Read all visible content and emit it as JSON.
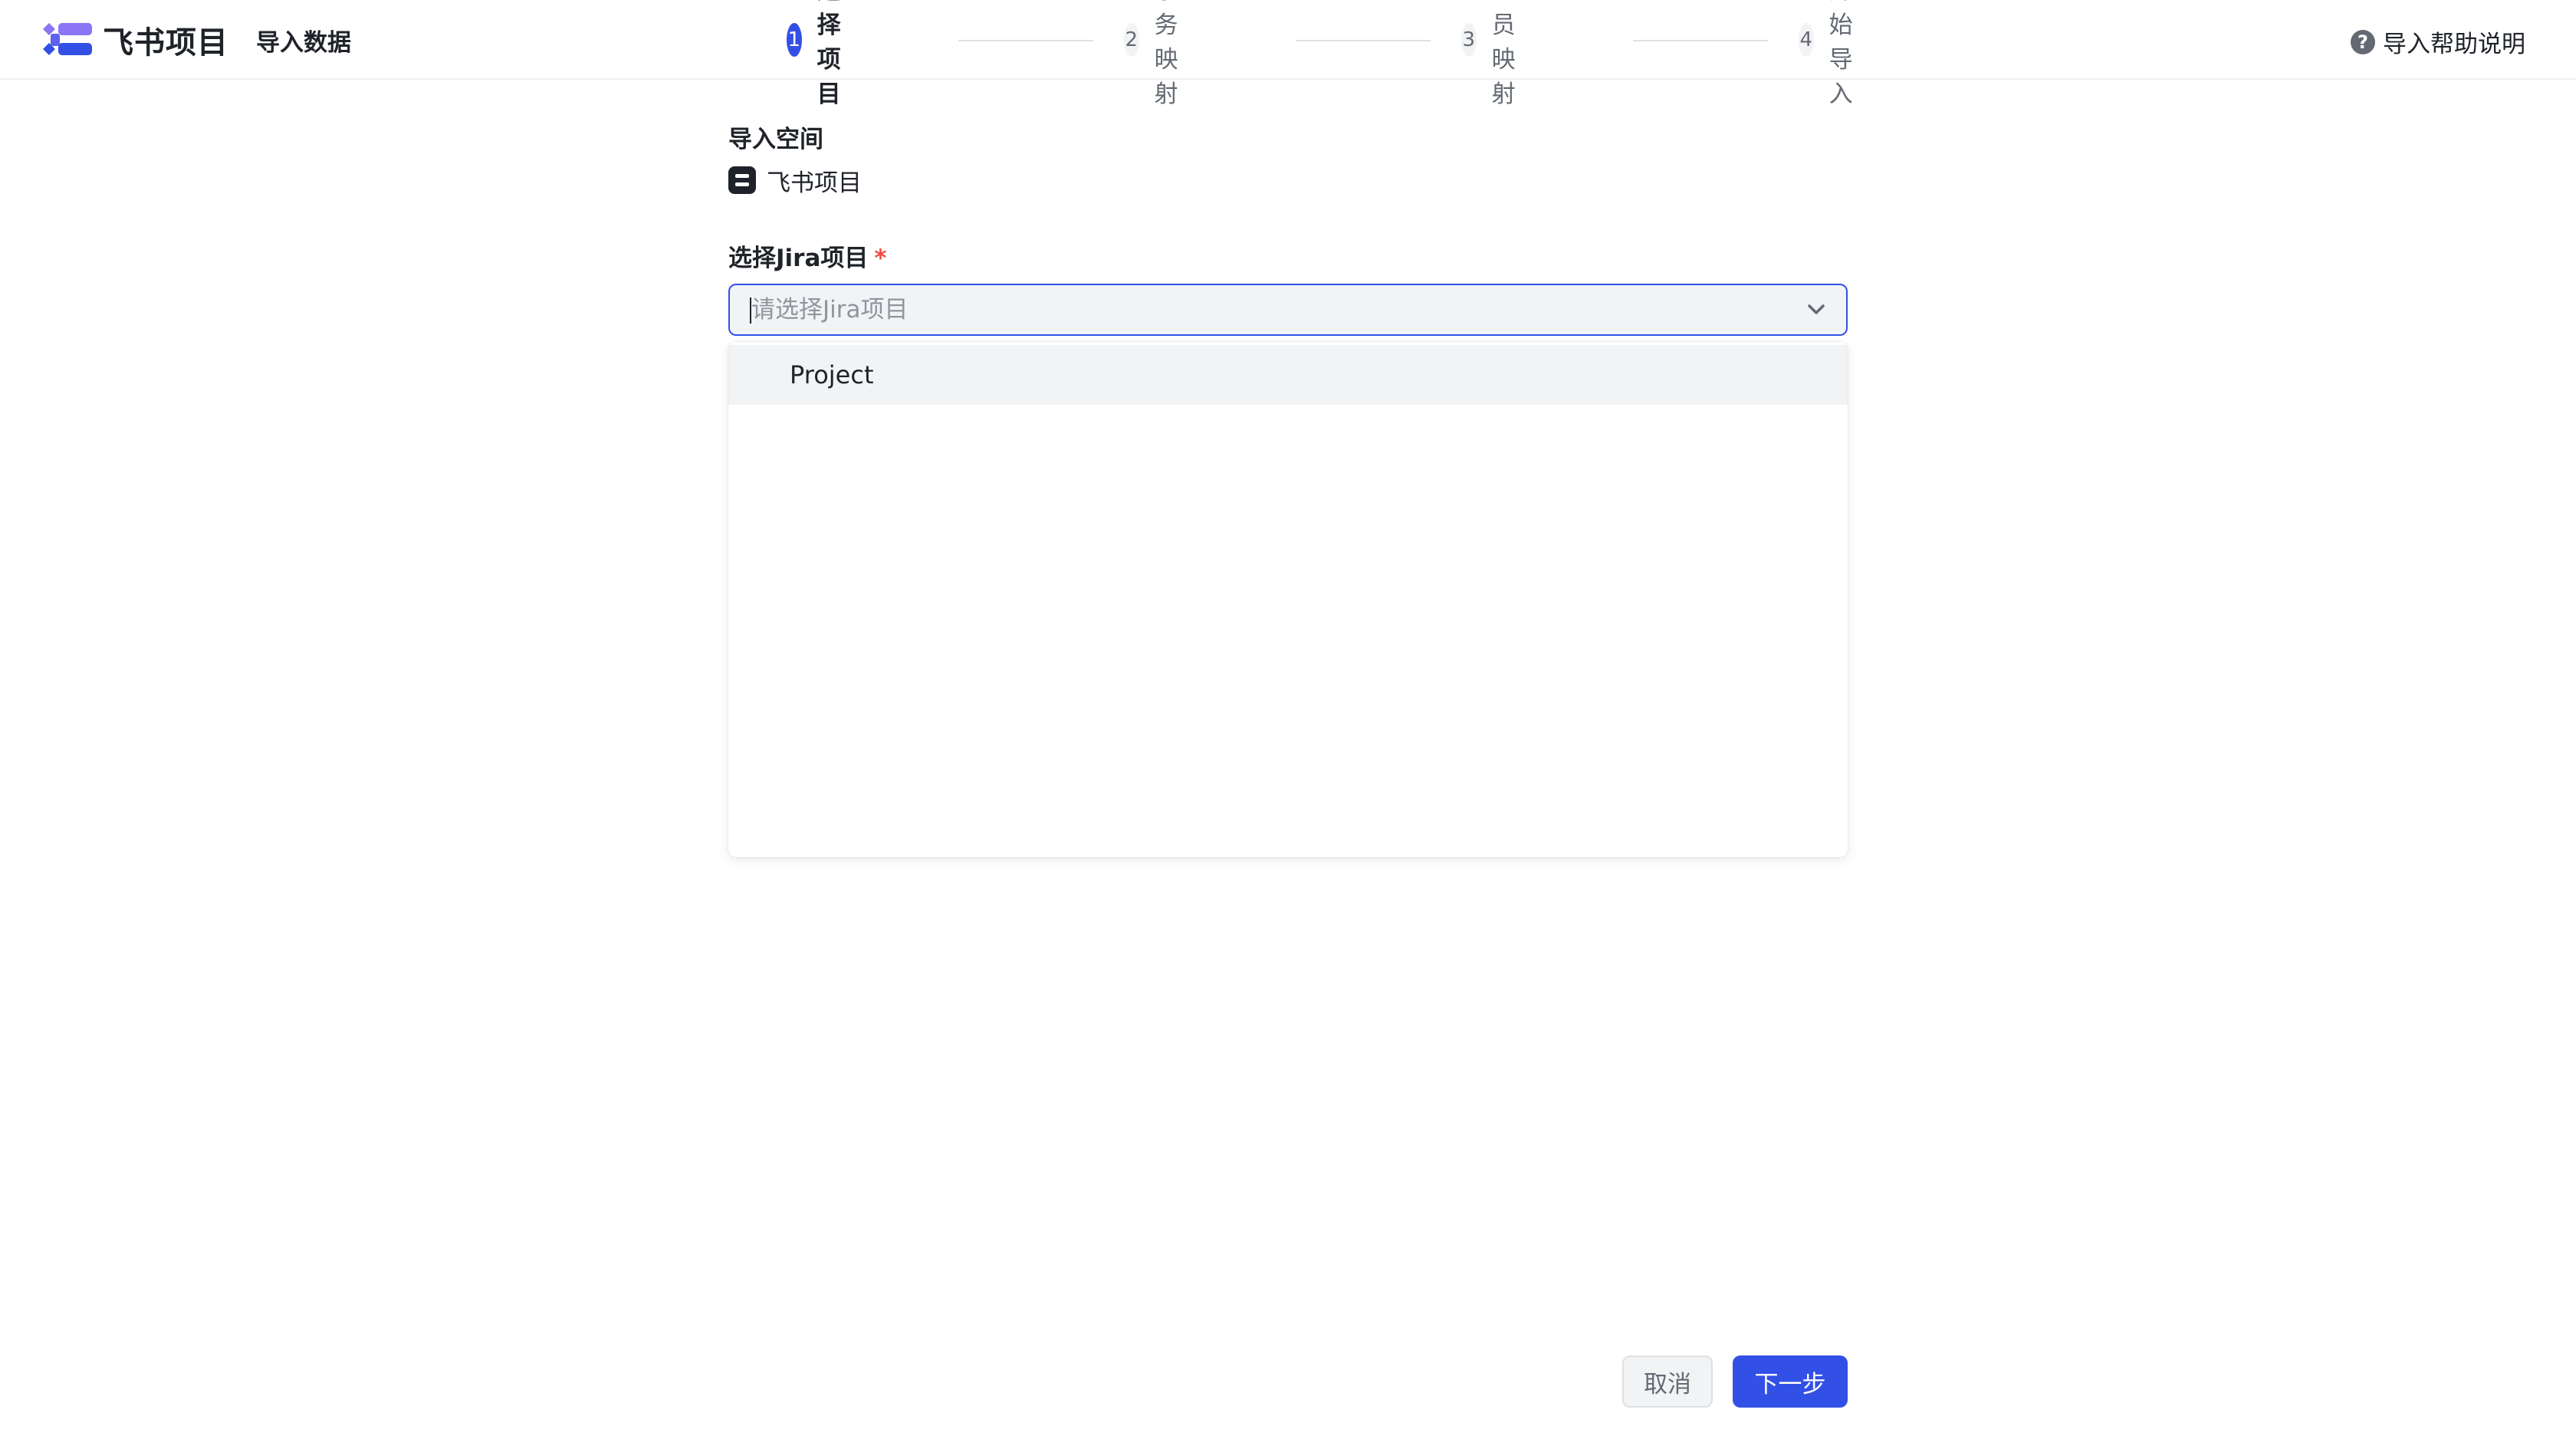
{
  "header": {
    "app_name": "飞书项目",
    "page_label": "导入数据",
    "help_label": "导入帮助说明",
    "help_icon": "question-circle-icon",
    "logo_icon": "feishu-project-logo-icon"
  },
  "steps": [
    {
      "num": "1",
      "label": "选择项目",
      "active": true
    },
    {
      "num": "2",
      "label": "事务映射",
      "active": false
    },
    {
      "num": "3",
      "label": "人员映射",
      "active": false
    },
    {
      "num": "4",
      "label": "开始导入",
      "active": false
    }
  ],
  "form": {
    "space_label": "导入空间",
    "space_name": "飞书项目",
    "jira_label": "选择Jira项目",
    "required_mark": "*",
    "select_placeholder": "请选择Jira项目",
    "chevron_icon": "chevron-down-icon"
  },
  "dropdown": {
    "options": [
      "Project"
    ]
  },
  "footer": {
    "cancel_label": "取消",
    "next_label": "下一步"
  },
  "colors": {
    "accent": "#3350e6",
    "required": "#f54a45",
    "muted_text": "#646a73"
  }
}
